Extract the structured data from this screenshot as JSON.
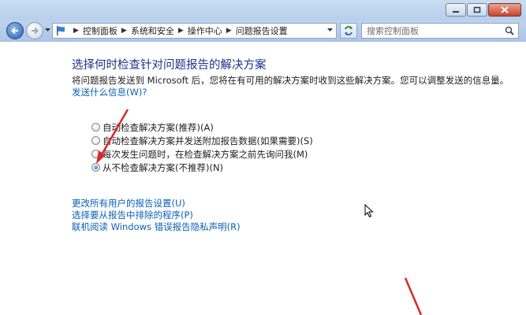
{
  "window": {
    "breadcrumb": [
      "控制面板",
      "系统和安全",
      "操作中心",
      "问题报告设置"
    ],
    "search_placeholder": "搜索控制面板"
  },
  "content": {
    "heading": "选择何时检查针对问题报告的解决方案",
    "description": "将问题报告发送到 Microsoft 后，您将在有可用的解决方案时收到这些解决方案。您可以调整发送的信息量。",
    "help_link": "发送什么信息(W)?",
    "options": [
      {
        "label": "自动检查解决方案(推荐)(A)",
        "checked": false
      },
      {
        "label": "自动检查解决方案并发送附加报告数据(如果需要)(S)",
        "checked": false
      },
      {
        "label": "每次发生问题时，在检查解决方案之前先询问我(M)",
        "checked": false
      },
      {
        "label": "从不检查解决方案(不推荐)(N)",
        "checked": true
      }
    ],
    "links": [
      "更改所有用户的报告设置(U)",
      "选择要从报告中排除的程序(P)",
      "联机阅读 Windows 错误报告隐私声明(R)"
    ]
  },
  "colors": {
    "heading": "#1e3287",
    "link": "#0b5fb8",
    "annotation_arrow": "#d42a2a"
  },
  "icons": {
    "back": "back-arrow-icon",
    "forward": "forward-arrow-icon",
    "location": "control-panel-flag-icon",
    "refresh": "refresh-icon",
    "search": "search-icon"
  }
}
